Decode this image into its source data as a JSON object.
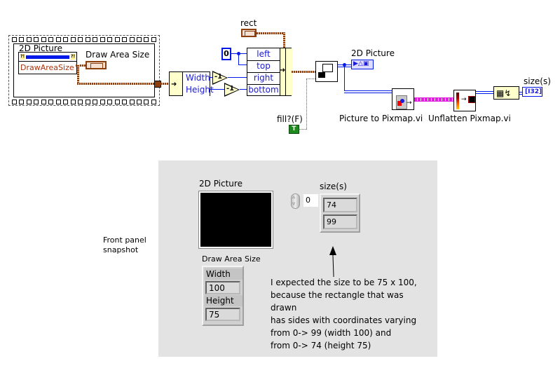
{
  "block_diagram": {
    "sequence_frame": {
      "picture_node_label": "2D Picture",
      "property": "DrawAreaSize",
      "draw_area_size_label": "Draw Area Size"
    },
    "unbundle": {
      "fields": [
        "Width",
        "Height"
      ]
    },
    "decrement_labels": [
      "-1",
      "-1"
    ],
    "constant_zero": "0",
    "rect_label": "rect",
    "bundle": {
      "fields": [
        "left",
        "top",
        "right",
        "bottom"
      ]
    },
    "fill_label": "fill?(F)",
    "fill_constant": "T",
    "picture_indicator_label": "2D Picture",
    "picture_to_pixmap_label": "Picture to Pixmap.vi",
    "unflatten_pixmap_label": "Unflatten Pixmap.vi",
    "size_indicator_label": "size(s)",
    "size_indicator_type": "[I32]"
  },
  "front_panel": {
    "caption": "Front panel\nsnapshot",
    "picture_label": "2D Picture",
    "size_label": "size(s)",
    "array_index": "0",
    "size_values": [
      "74",
      "99"
    ],
    "draw_area_label": "Draw Area Size",
    "width_label": "Width",
    "width_value": "100",
    "height_label": "Height",
    "height_value": "75",
    "note_lines": [
      "I expected the size to be 75 x 100,",
      "because the rectangle that was drawn",
      "has sides with coordinates varying",
      "from 0-> 99 (width 100) and",
      "from 0-> 74 (height 75)"
    ]
  },
  "colors": {
    "cluster_wire": "#8c3f0d",
    "numeric_wire": "#0018e8",
    "boolean_wire": "#1e8a1e",
    "pixmap_wire": "#e21fe0",
    "panel_bg": "#e3e3e3"
  }
}
